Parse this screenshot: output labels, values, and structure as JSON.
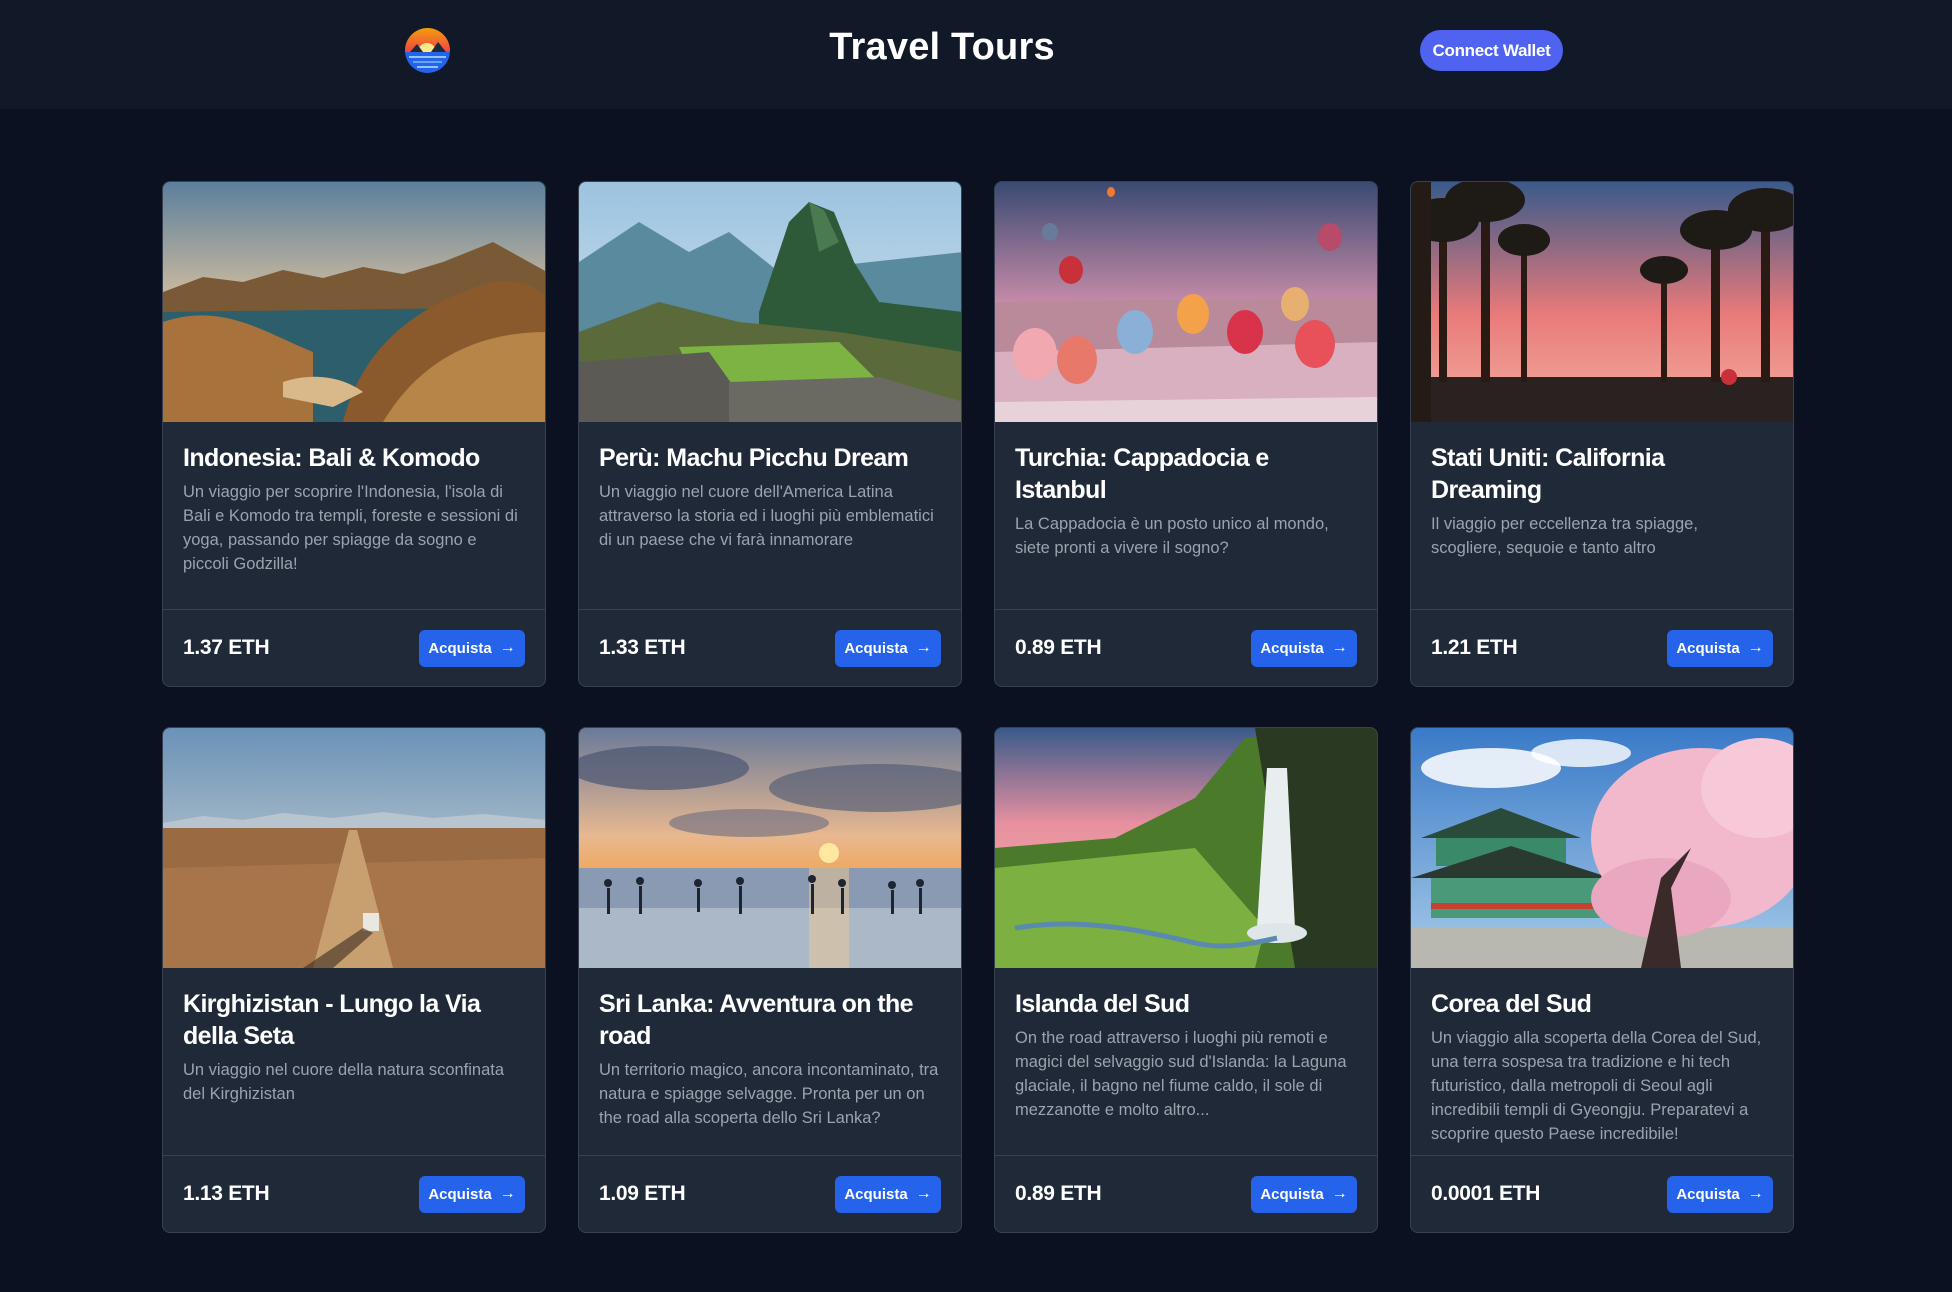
{
  "header": {
    "title": "Travel Tours",
    "wallet_button": "Connect Wallet",
    "logo_icon": "sunset-logo-icon"
  },
  "tours": [
    {
      "title": "Indonesia: Bali & Komodo",
      "description": "Un viaggio per scoprire l'Indonesia, l'isola di Bali e Komodo tra templi, foreste e sessioni di yoga, passando per spiagge da sogno e piccoli Godzilla!",
      "price": "1.37 ETH",
      "button": "Acquista",
      "image": "komodo-islands-photo"
    },
    {
      "title": "Perù: Machu Picchu Dream",
      "description": "Un viaggio nel cuore dell'America Latina attraverso la storia ed i luoghi più emblematici di un paese che vi farà innamorare",
      "price": "1.33 ETH",
      "button": "Acquista",
      "image": "machu-picchu-photo"
    },
    {
      "title": "Turchia: Cappadocia e Istanbul",
      "description": "La Cappadocia è un posto unico al mondo, siete pronti a vivere il sogno?",
      "price": "0.89 ETH",
      "button": "Acquista",
      "image": "cappadocia-balloons-photo"
    },
    {
      "title": "Stati Uniti: California Dreaming",
      "description": "Il viaggio per eccellenza tra spiagge, scogliere, sequoie e tanto altro",
      "price": "1.21 ETH",
      "button": "Acquista",
      "image": "california-palms-photo"
    },
    {
      "title": "Kirghizistan - Lungo la Via della Seta",
      "description": "Un viaggio nel cuore della natura sconfinata del Kirghizistan",
      "price": "1.13 ETH",
      "button": "Acquista",
      "image": "kyrgyzstan-road-photo"
    },
    {
      "title": "Sri Lanka: Avventura on the road",
      "description": "Un territorio magico, ancora incontaminato, tra natura e spiagge selvagge. Pronta per un on the road alla scoperta dello Sri Lanka?",
      "price": "1.09 ETH",
      "button": "Acquista",
      "image": "sri-lanka-stilt-fishermen-photo"
    },
    {
      "title": "Islanda del Sud",
      "description": "On the road attraverso i luoghi più remoti e magici del selvaggio sud d'Islanda: la Laguna glaciale, il bagno nel fiume caldo, il sole di mezzanotte e molto altro...",
      "price": "0.89 ETH",
      "button": "Acquista",
      "image": "iceland-waterfall-photo"
    },
    {
      "title": "Corea del Sud",
      "description": "Un viaggio alla scoperta della Corea del Sud, una terra sospesa tra tradizione e hi tech futuristico, dalla metropoli di Seoul agli incredibili templi di Gyeongju. Preparatevi a scoprire questo Paese incredibile!",
      "price": "0.0001 ETH",
      "button": "Acquista",
      "image": "korea-temple-blossoms-photo"
    }
  ]
}
